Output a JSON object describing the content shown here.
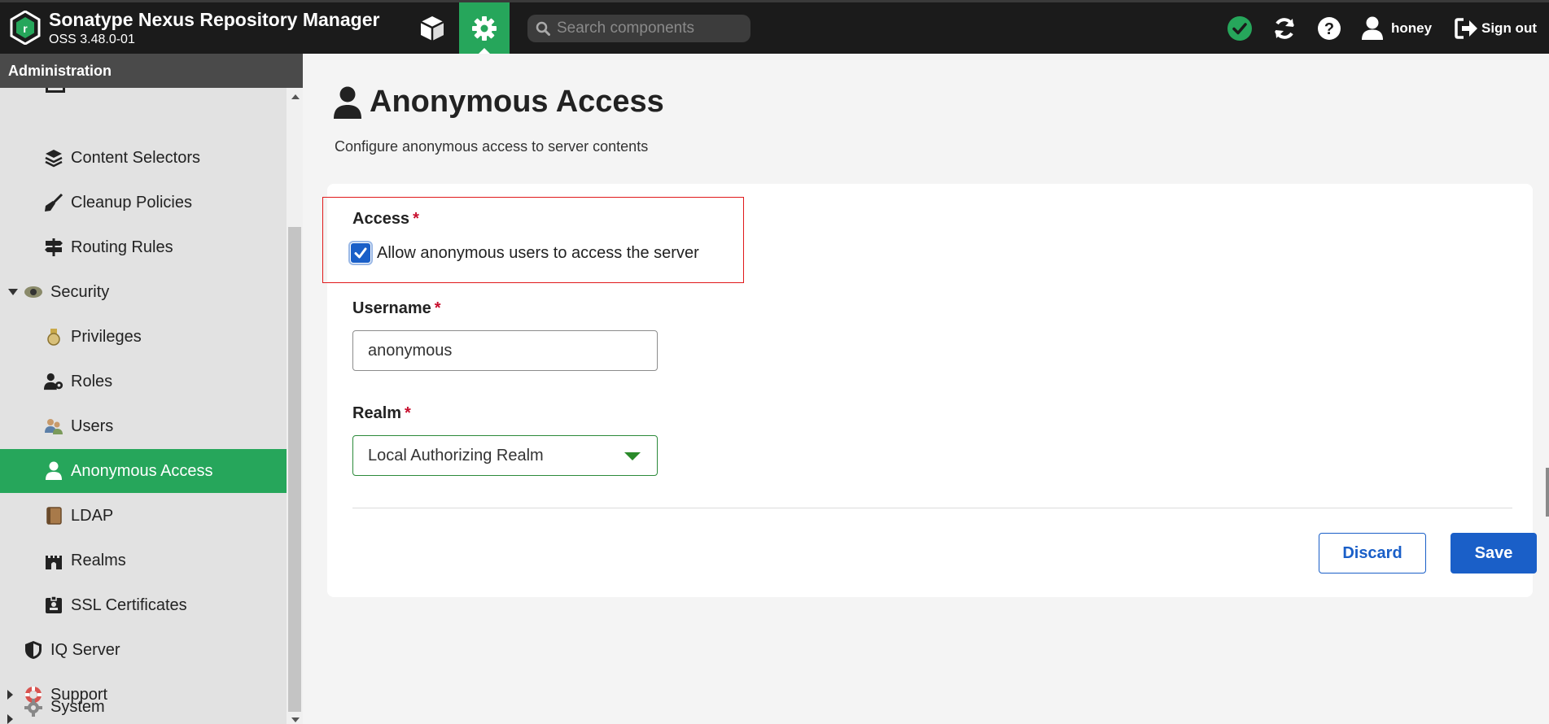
{
  "header": {
    "app_title": "Sonatype Nexus Repository Manager",
    "app_version": "OSS 3.48.0-01",
    "search_placeholder": "Search components",
    "user_label": "honey",
    "signout_label": "Sign out"
  },
  "sidebar": {
    "title": "Administration",
    "items": [
      {
        "label": "Content Selectors",
        "icon": "layers-icon"
      },
      {
        "label": "Cleanup Policies",
        "icon": "broom-icon"
      },
      {
        "label": "Routing Rules",
        "icon": "signpost-icon"
      },
      {
        "label": "Security",
        "icon": "badge-icon"
      },
      {
        "label": "Privileges",
        "icon": "medal-icon"
      },
      {
        "label": "Roles",
        "icon": "user-tie-icon"
      },
      {
        "label": "Users",
        "icon": "users-icon"
      },
      {
        "label": "Anonymous Access",
        "icon": "user-icon"
      },
      {
        "label": "LDAP",
        "icon": "book-icon"
      },
      {
        "label": "Realms",
        "icon": "castle-icon"
      },
      {
        "label": "SSL Certificates",
        "icon": "id-card-icon"
      },
      {
        "label": "IQ Server",
        "icon": "shield-icon"
      },
      {
        "label": "Support",
        "icon": "lifebuoy-icon"
      },
      {
        "label": "System",
        "icon": "gear-icon"
      }
    ]
  },
  "page": {
    "title": "Anonymous Access",
    "subtitle": "Configure anonymous access to server contents"
  },
  "form": {
    "access_label": "Access",
    "access_checkbox_label": "Allow anonymous users to access the server",
    "access_checked": true,
    "username_label": "Username",
    "username_value": "anonymous",
    "realm_label": "Realm",
    "realm_value": "Local Authorizing Realm",
    "required_mark": "*",
    "discard_label": "Discard",
    "save_label": "Save"
  },
  "colors": {
    "accent": "#26a65b",
    "primary": "#1a5fc8",
    "required": "#c8102e",
    "header_bg": "#1b1b1b"
  }
}
